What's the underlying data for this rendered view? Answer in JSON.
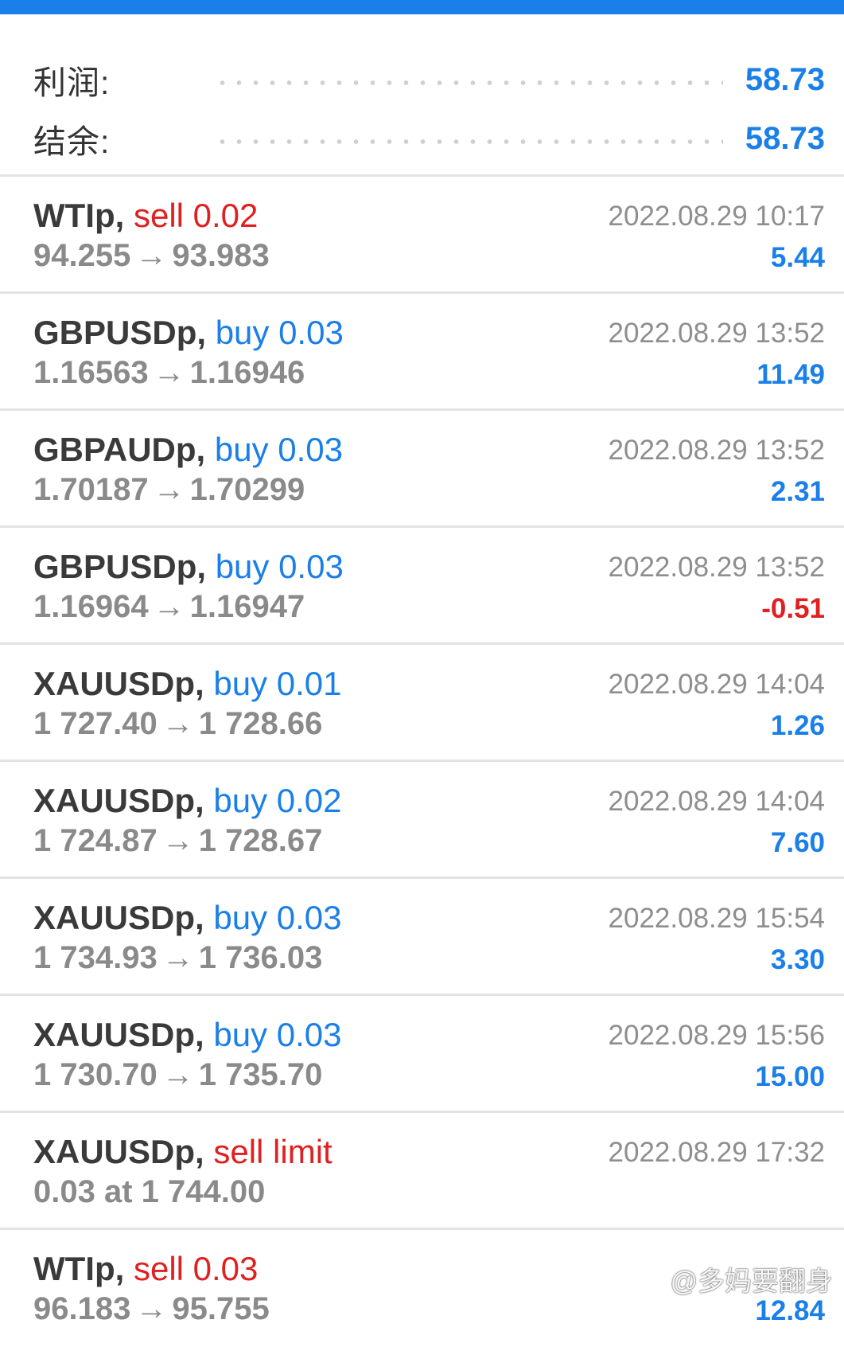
{
  "summary": {
    "profit_label": "利润:",
    "profit_value": "58.73",
    "balance_label": "结余:",
    "balance_value": "58.73"
  },
  "trades": [
    {
      "symbol": "WTIp,",
      "action": "sell 0.02",
      "action_type": "sell",
      "open": "94.255",
      "arrow": "→",
      "close": "93.983",
      "time": "2022.08.29 10:17",
      "profit": "5.44",
      "profit_sign": "pos"
    },
    {
      "symbol": "GBPUSDp,",
      "action": "buy 0.03",
      "action_type": "buy",
      "open": "1.16563",
      "arrow": "→",
      "close": "1.16946",
      "time": "2022.08.29 13:52",
      "profit": "11.49",
      "profit_sign": "pos"
    },
    {
      "symbol": "GBPAUDp,",
      "action": "buy 0.03",
      "action_type": "buy",
      "open": "1.70187",
      "arrow": "→",
      "close": "1.70299",
      "time": "2022.08.29 13:52",
      "profit": "2.31",
      "profit_sign": "pos"
    },
    {
      "symbol": "GBPUSDp,",
      "action": "buy 0.03",
      "action_type": "buy",
      "open": "1.16964",
      "arrow": "→",
      "close": "1.16947",
      "time": "2022.08.29 13:52",
      "profit": "-0.51",
      "profit_sign": "neg"
    },
    {
      "symbol": "XAUUSDp,",
      "action": "buy 0.01",
      "action_type": "buy",
      "open": "1 727.40",
      "arrow": "→",
      "close": "1 728.66",
      "time": "2022.08.29 14:04",
      "profit": "1.26",
      "profit_sign": "pos"
    },
    {
      "symbol": "XAUUSDp,",
      "action": "buy 0.02",
      "action_type": "buy",
      "open": "1 724.87",
      "arrow": "→",
      "close": "1 728.67",
      "time": "2022.08.29 14:04",
      "profit": "7.60",
      "profit_sign": "pos"
    },
    {
      "symbol": "XAUUSDp,",
      "action": "buy 0.03",
      "action_type": "buy",
      "open": "1 734.93",
      "arrow": "→",
      "close": "1 736.03",
      "time": "2022.08.29 15:54",
      "profit": "3.30",
      "profit_sign": "pos"
    },
    {
      "symbol": "XAUUSDp,",
      "action": "buy 0.03",
      "action_type": "buy",
      "open": "1 730.70",
      "arrow": "→",
      "close": "1 735.70",
      "time": "2022.08.29 15:56",
      "profit": "15.00",
      "profit_sign": "pos"
    },
    {
      "symbol": "XAUUSDp,",
      "action": "sell limit",
      "action_type": "sell",
      "open": "0.03 at 1 744.00",
      "arrow": "",
      "close": "",
      "time": "2022.08.29 17:32",
      "profit": "",
      "profit_sign": "pos"
    },
    {
      "symbol": "WTIp,",
      "action": "sell 0.03",
      "action_type": "sell",
      "open": "96.183",
      "arrow": "→",
      "close": "95.755",
      "time": "",
      "profit": "12.84",
      "profit_sign": "pos"
    }
  ],
  "watermark": "@多妈要翻身",
  "colors": {
    "accent_blue": "#1a7fe8",
    "sell_red": "#e02020",
    "muted_gray": "#8a8a8a"
  }
}
